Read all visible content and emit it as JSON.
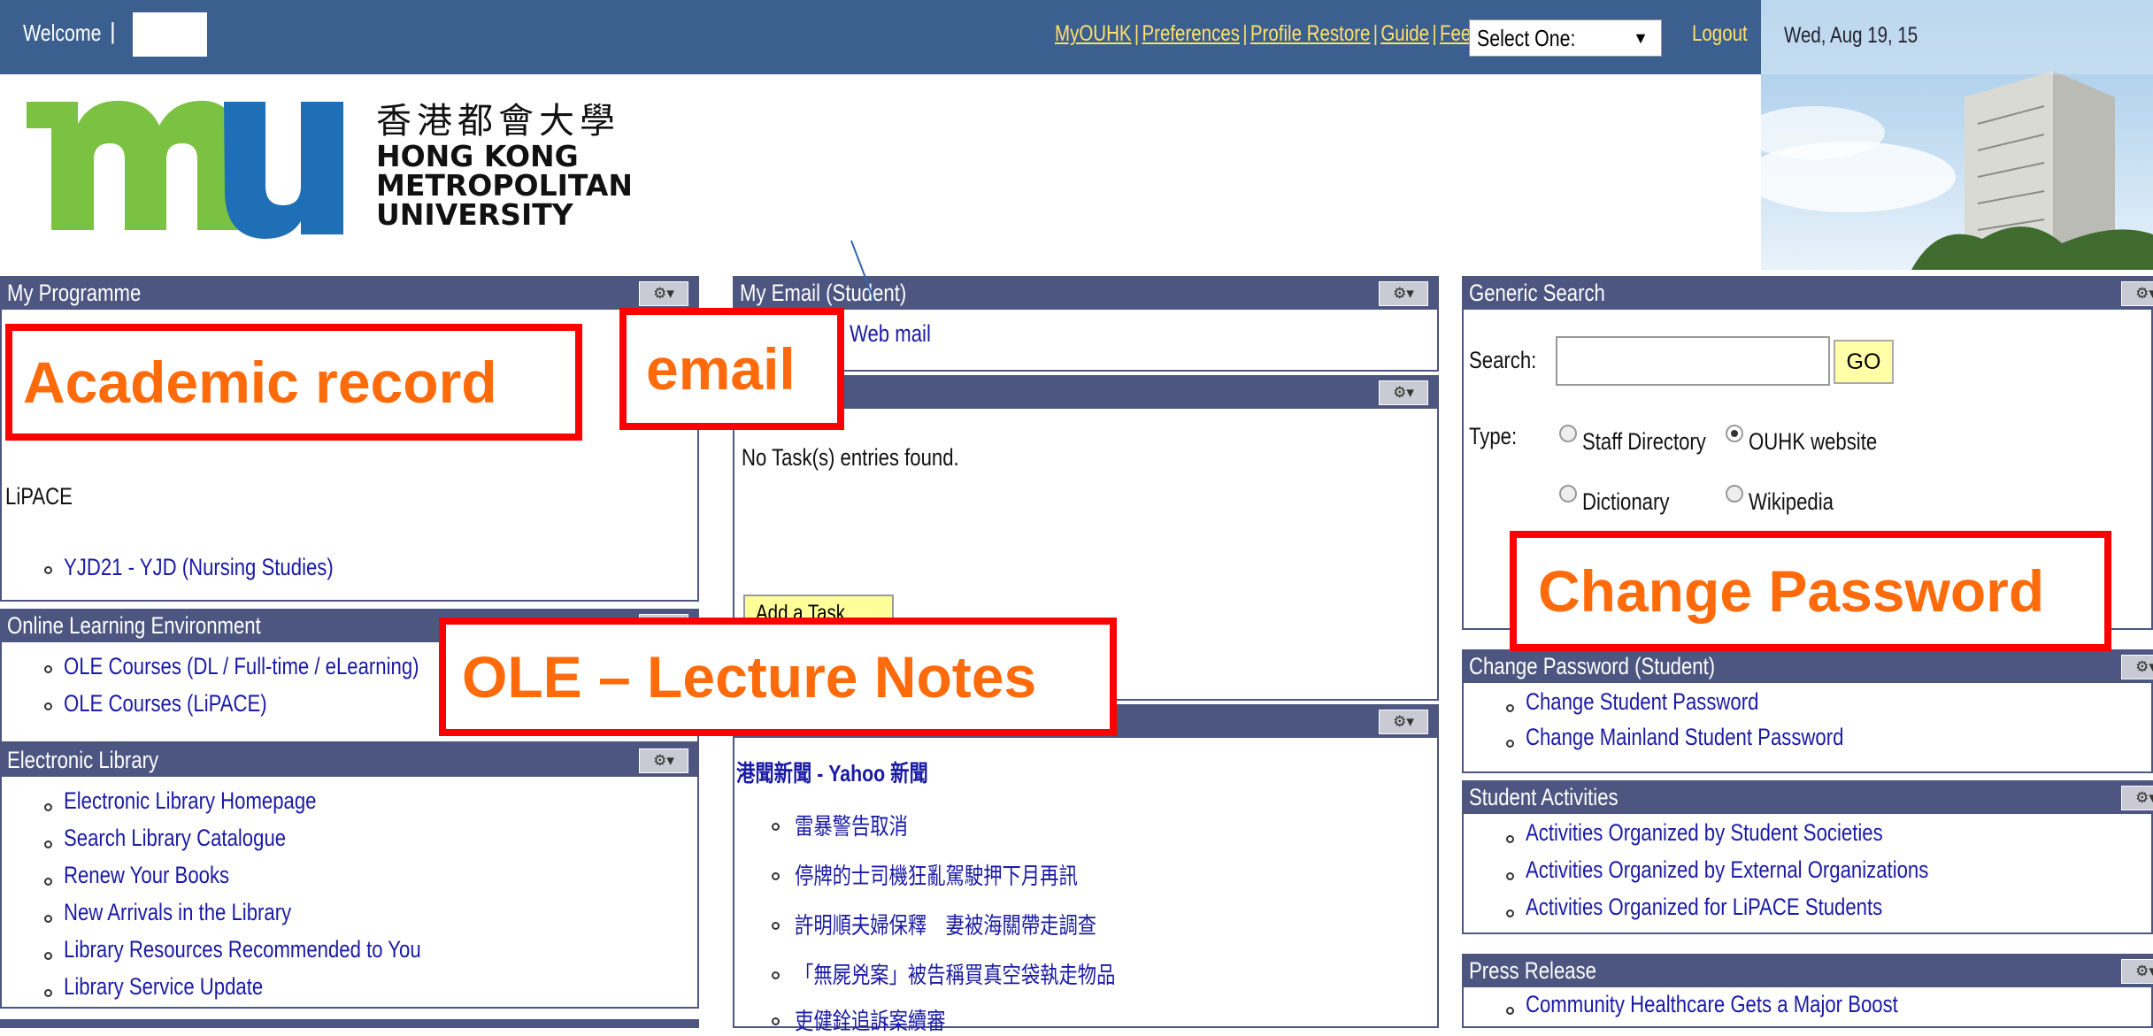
{
  "topbar": {
    "welcome": "Welcome",
    "welcome_sep": "|",
    "links": [
      "MyOUHK",
      "Preferences",
      "Profile Restore",
      "Guide",
      "Feedback"
    ],
    "select": "Select One:",
    "logout": "Logout",
    "date": "Wed, Aug 19, 15"
  },
  "logo": {
    "chinese": "香港都會大學",
    "en1": "HONG KONG",
    "en2": "METROPOLITAN",
    "en3": "UNIVERSITY"
  },
  "my_programme": {
    "title": "My Programme",
    "section": "LiPACE",
    "item": "YJD21 - YJD (Nursing Studies)"
  },
  "ole": {
    "title": "Online Learning Environment",
    "items": [
      "OLE Courses (DL / Full-time / eLearning)",
      "OLE Courses (LiPACE)"
    ]
  },
  "library": {
    "title": "Electronic Library",
    "items": [
      "Electronic Library Homepage",
      "Search Library Catalogue",
      "Renew Your Books",
      "New Arrivals in the Library",
      "Library Resources Recommended to You",
      "Library Service Update"
    ]
  },
  "email": {
    "title": "My Email (Student)",
    "link": "Web mail"
  },
  "tasks": {
    "empty": "No Task(s) entries found.",
    "add_button": "Add a Task"
  },
  "news": {
    "source": "港聞新聞 - Yahoo 新聞",
    "items": [
      "雷暴警告取消",
      "停牌的士司機狂亂駕駛押下月再訊",
      "許明順夫婦保釋　妻被海關帶走調查",
      "「無屍兇案」被告稱買真空袋執走物品",
      "吏健銓追訴案續審"
    ]
  },
  "search": {
    "title": "Generic Search",
    "label": "Search:",
    "go": "GO",
    "type_label": "Type:",
    "options": [
      "Staff Directory",
      "OUHK website",
      "Dictionary",
      "Wikipedia"
    ],
    "selected": "OUHK website"
  },
  "change_password": {
    "title": "Change Password (Student)",
    "items": [
      "Change Student Password",
      "Change Mainland Student Password"
    ]
  },
  "activities": {
    "title": "Student Activities",
    "items": [
      "Activities Organized by Student Societies",
      "Activities Organized by External Organizations",
      "Activities Organized for LiPACE Students"
    ]
  },
  "press": {
    "title": "Press Release",
    "items": [
      "Community Healthcare Gets a Major Boost"
    ]
  },
  "overlays": {
    "academic": "Academic record",
    "email": "email",
    "ole": "OLE – Lecture Notes",
    "password": "Change Password"
  },
  "colors": {
    "topbar": "#3b5f8f",
    "portlet_header": "#4c5680",
    "link": "#1a1aa6",
    "overlay_border": "#ff0000",
    "overlay_text": "#ff6a0a"
  }
}
